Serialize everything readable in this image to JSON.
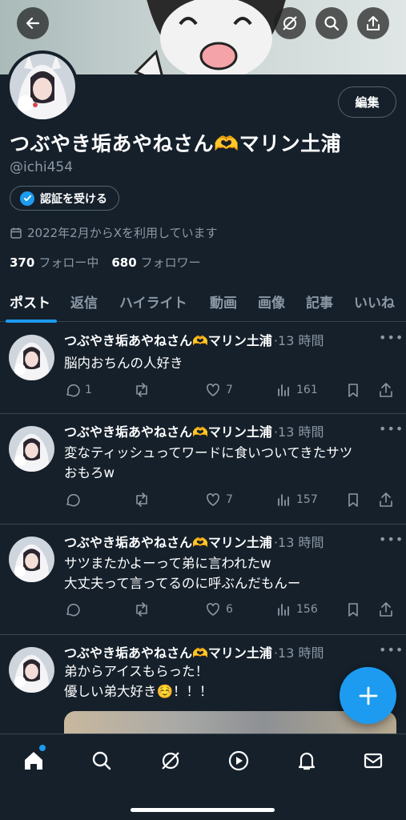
{
  "profile": {
    "edit_label": "編集",
    "display_name": "つぶやき垢あやねさん🫶マリン土浦",
    "handle": "@ichi454",
    "verify_label": "認証を受ける",
    "joined": "2022年2月からXを利用しています",
    "following_count": "370",
    "following_label": "フォロー中",
    "followers_count": "680",
    "followers_label": "フォロワー"
  },
  "tabs": [
    "ポスト",
    "返信",
    "ハイライト",
    "動画",
    "画像",
    "記事",
    "いいね"
  ],
  "posts": [
    {
      "name": "つぶやき垢あやねさん🫶マリン土浦",
      "meta": "·13 時間",
      "lines": [
        "脳内おちんの人好き"
      ],
      "replies": "1",
      "likes": "7",
      "views": "161"
    },
    {
      "name": "つぶやき垢あやねさん🫶マリン土浦",
      "meta": "·13 時間",
      "lines": [
        "変なティッシュってワードに食いついてきたサツ",
        "おもろw"
      ],
      "replies": "",
      "likes": "7",
      "views": "157"
    },
    {
      "name": "つぶやき垢あやねさん🫶マリン土浦",
      "meta": "·13 時間",
      "lines": [
        "サツまたかよーって弟に言われたw",
        "大丈夫って言ってるのに呼ぶんだもんー"
      ],
      "replies": "",
      "likes": "6",
      "views": "156"
    },
    {
      "name": "つぶやき垢あやねさん🫶マリン土浦",
      "meta": "·13 時間",
      "lines": [
        "弟からアイスもらった！",
        "優しい弟大好き☺️！！！"
      ]
    }
  ],
  "colors": {
    "accent": "#1d9bf0",
    "background": "#15202b",
    "muted": "#8b98a5",
    "border": "#38444d"
  }
}
